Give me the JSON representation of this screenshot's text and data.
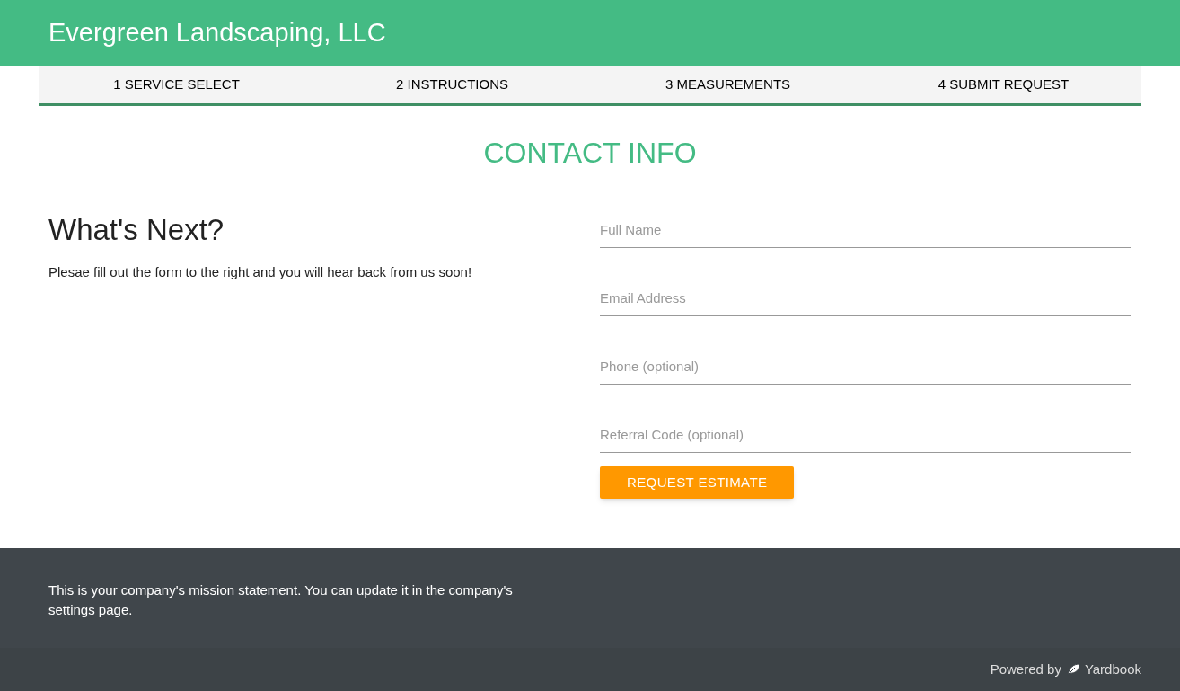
{
  "header": {
    "company": "Evergreen Landscaping, LLC"
  },
  "steps": [
    {
      "label": "1 SERVICE SELECT"
    },
    {
      "label": "2 INSTRUCTIONS"
    },
    {
      "label": "3 MEASUREMENTS"
    },
    {
      "label": "4 SUBMIT REQUEST"
    }
  ],
  "title": "CONTACT INFO",
  "intro": {
    "heading": "What's Next?",
    "text": "Plesae fill out the form to the right and you will hear back from us soon!"
  },
  "form": {
    "fields": [
      {
        "placeholder": "Full Name"
      },
      {
        "placeholder": "Email Address"
      },
      {
        "placeholder": "Phone (optional)"
      },
      {
        "placeholder": "Referral Code (optional)"
      }
    ],
    "button": "REQUEST ESTIMATE"
  },
  "footer": {
    "mission": "This is your company's mission statement. You can update it in the company's settings page.",
    "powered_by": "Powered by",
    "brand": "Yardbook"
  }
}
